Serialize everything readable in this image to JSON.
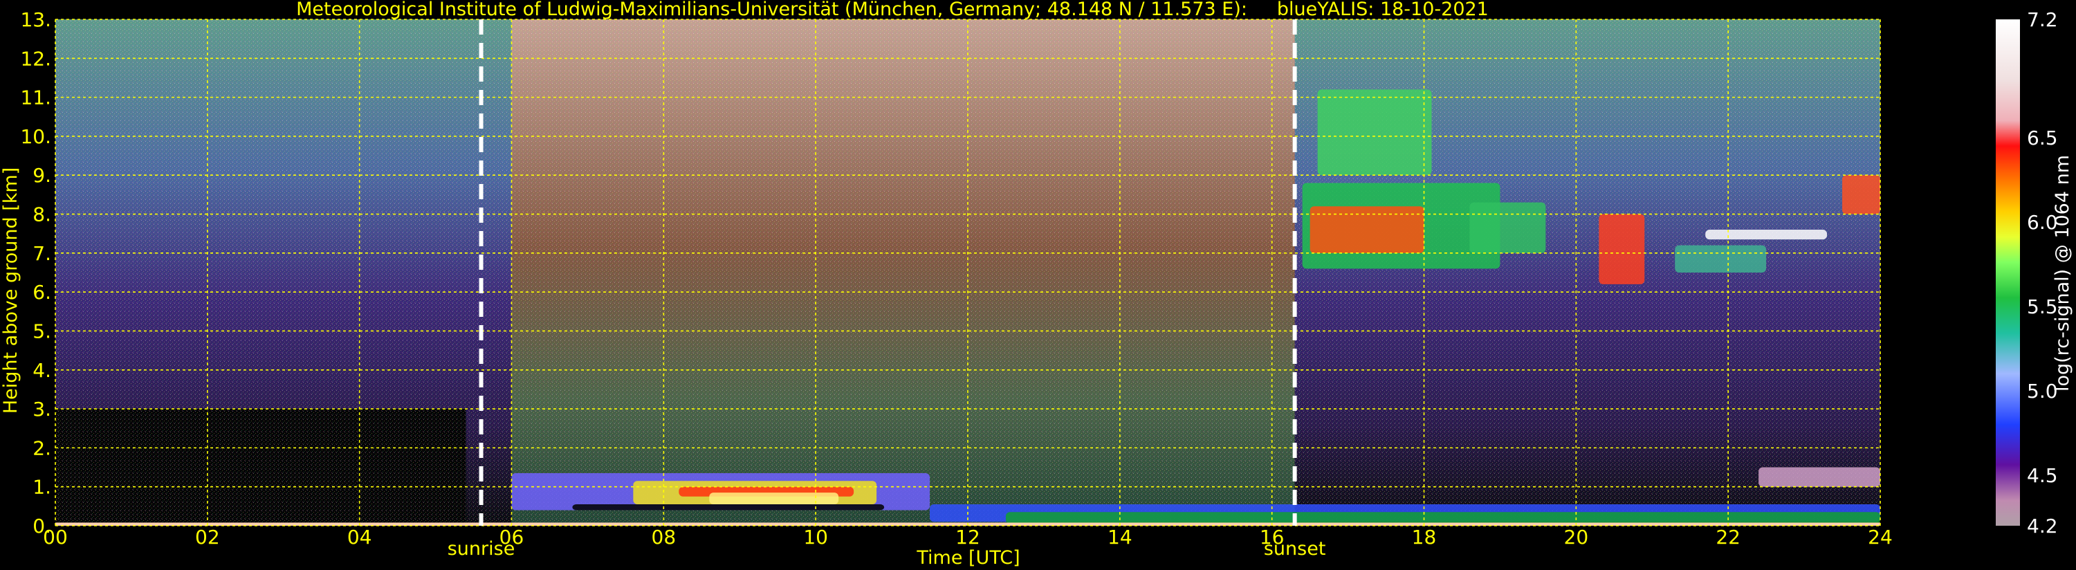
{
  "chart_data": {
    "type": "heatmap",
    "title": "Meteorological Institute of Ludwig-Maximilians-Universität (München, Germany; 48.148 N / 11.573 E):     blueYALIS: 18-10-2021",
    "xlabel": "Time [UTC]",
    "ylabel": "Height above ground [km]",
    "xlim": [
      0,
      24
    ],
    "ylim": [
      0,
      13
    ],
    "x_ticks": [
      "00",
      "02",
      "04",
      "06",
      "08",
      "10",
      "12",
      "14",
      "16",
      "18",
      "20",
      "22",
      "24"
    ],
    "y_ticks": [
      "0.",
      "1.",
      "2.",
      "3.",
      "4.",
      "5.",
      "6.",
      "7.",
      "8.",
      "9.",
      "10.",
      "11.",
      "12.",
      "13."
    ],
    "grid": true,
    "markers": [
      {
        "label": "sunrise",
        "x": 5.6
      },
      {
        "label": "sunset",
        "x": 16.3
      }
    ],
    "colorbar": {
      "label": "log(rc-signal) @ 1064 nm",
      "range": [
        4.2,
        7.2
      ],
      "ticks": [
        "7.2",
        "6.5",
        "6.0",
        "5.5",
        "5.0",
        "4.5",
        "4.2"
      ]
    }
  }
}
